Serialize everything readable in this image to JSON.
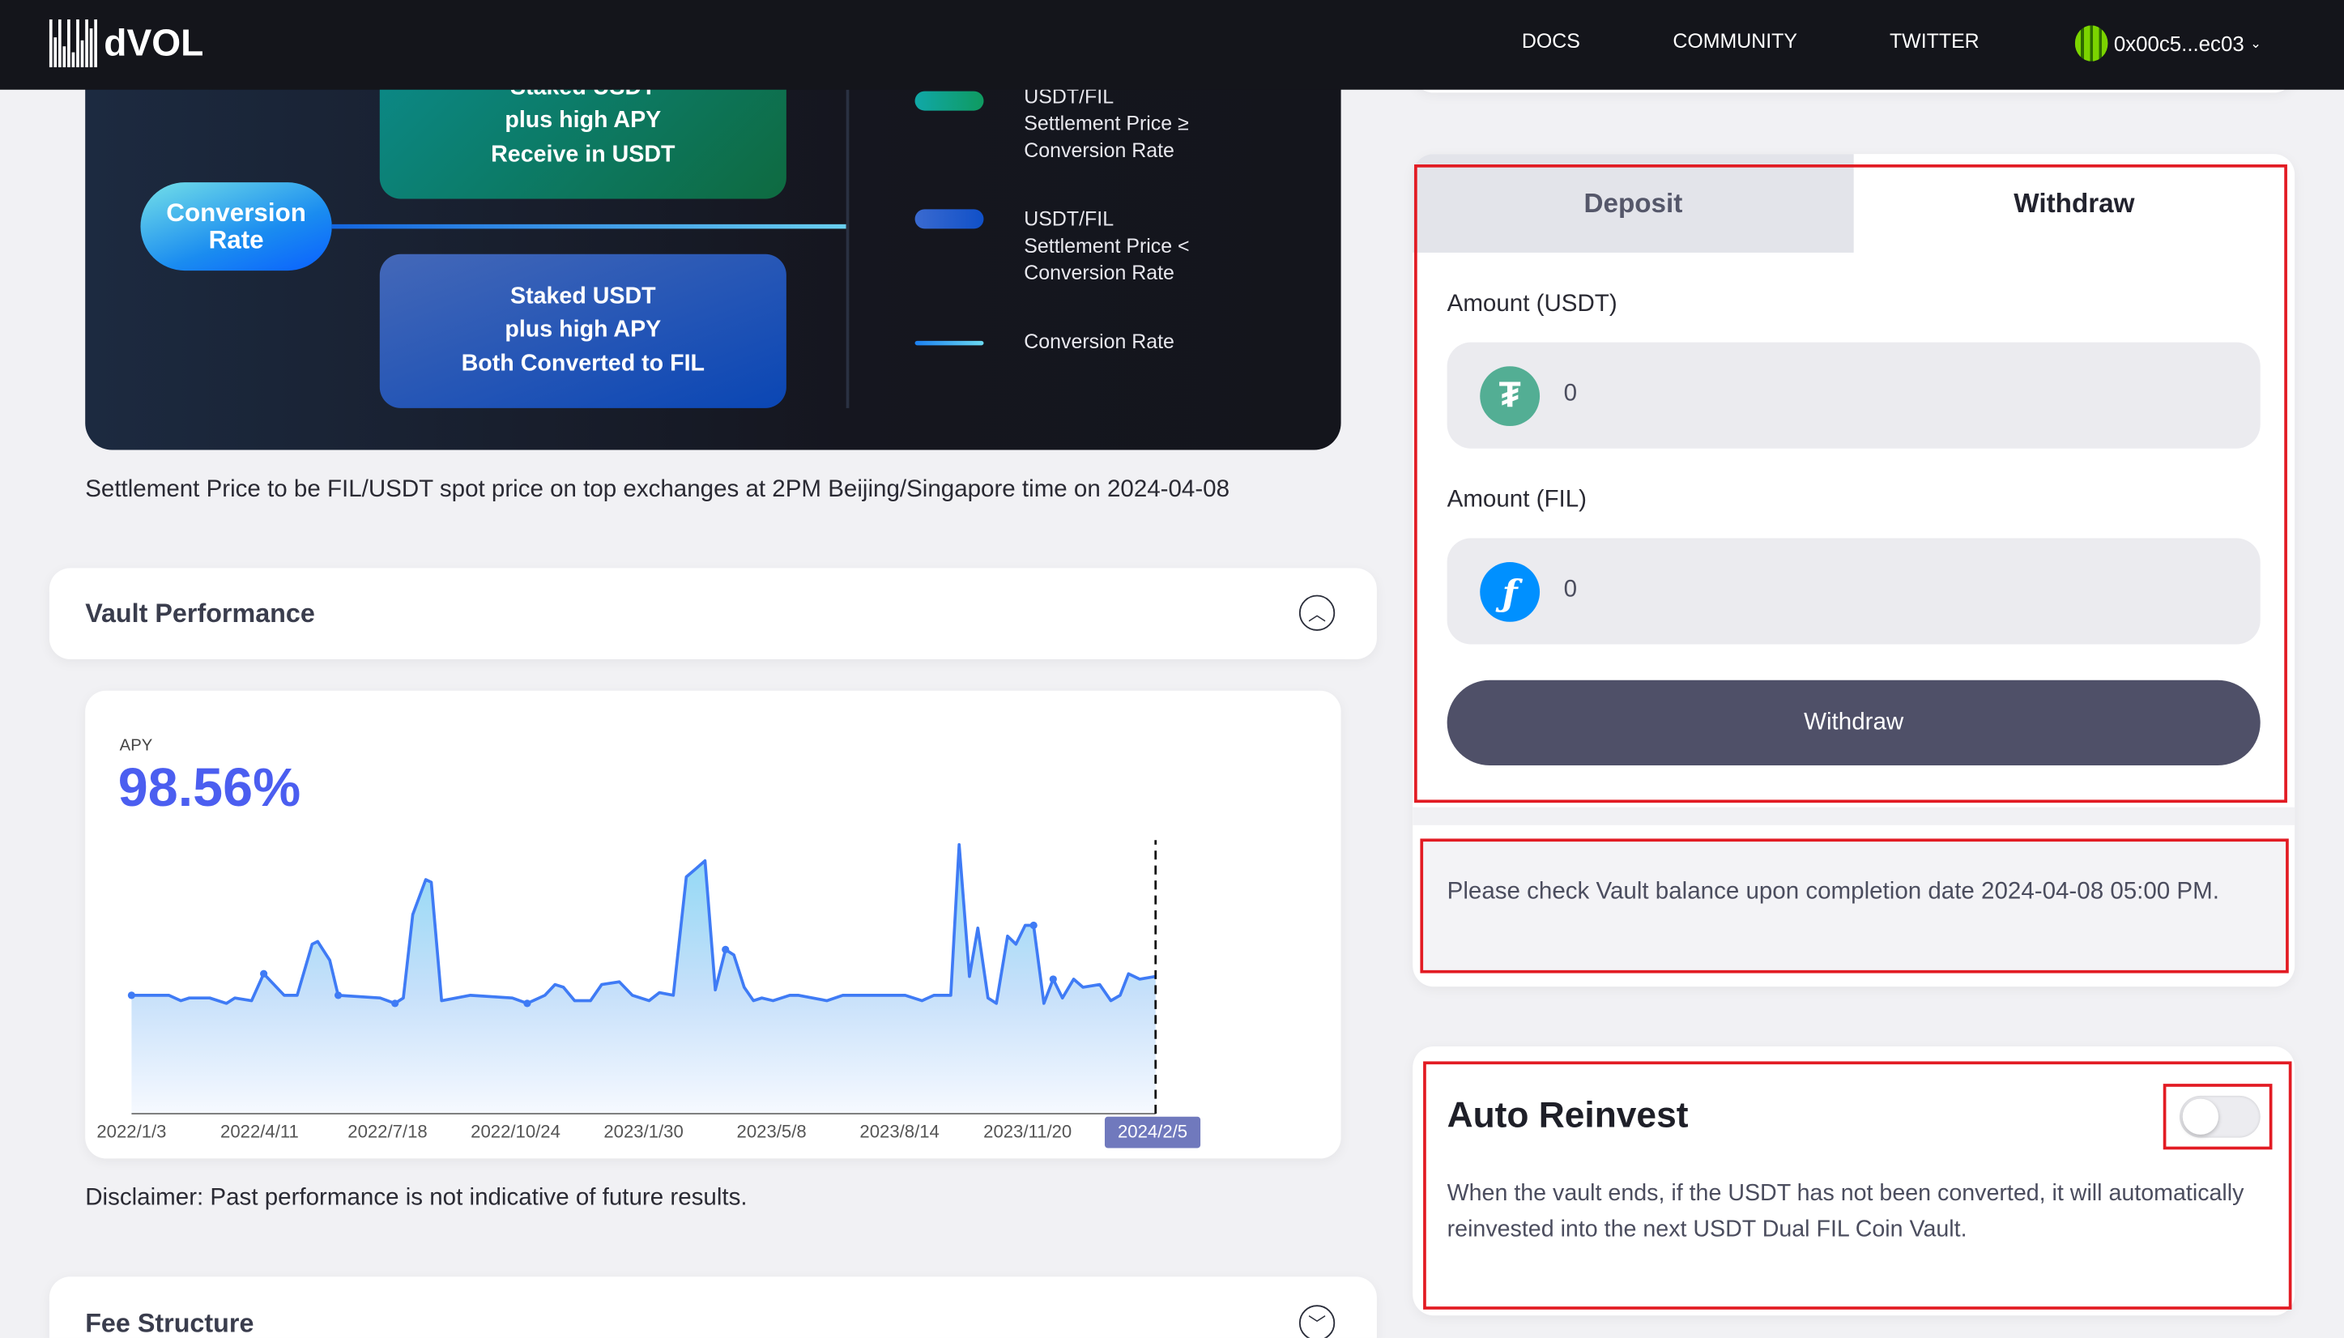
{
  "header": {
    "logo": "dVOL",
    "nav": [
      "DOCS",
      "COMMUNITY",
      "TWITTER"
    ],
    "wallet": "0x00c5...ec03"
  },
  "diagram": {
    "top_box": [
      "Staked USDT",
      "plus high APY",
      "Receive in USDT"
    ],
    "bottom_box": [
      "Staked USDT",
      "plus high APY",
      "Both Converted to FIL"
    ],
    "pill": [
      "Conversion",
      "Rate"
    ],
    "legend": [
      {
        "lines": [
          "USDT/FIL",
          "Settlement Price ≥",
          "Conversion Rate"
        ],
        "color": "#10a08a"
      },
      {
        "lines": [
          "USDT/FIL",
          "Settlement Price <",
          "Conversion Rate"
        ],
        "color": "#2a62d0"
      },
      {
        "lines": [
          "Conversion Rate"
        ],
        "color": "#3ab0f0"
      }
    ]
  },
  "settlement_note": "Settlement Price to be FIL/USDT spot price on top exchanges at 2PM Beijing/Singapore time on 2024-04-08",
  "vault_performance": {
    "title": "Vault Performance"
  },
  "apy": {
    "label": "APY",
    "value": "98.56%"
  },
  "chart_data": {
    "type": "area",
    "title": "APY",
    "xlabel": "",
    "ylabel": "",
    "x_unit": "weeks since 2022/1/3",
    "ylim": [
      0,
      100
    ],
    "tick_labels": [
      "2022/1/3",
      "2022/4/11",
      "2022/7/18",
      "2022/10/24",
      "2023/1/30",
      "2023/5/8",
      "2023/8/14",
      "2023/11/20",
      "2024/2/5"
    ],
    "highlighted_tick": "2024/2/5",
    "x": [
      0,
      4,
      5.3,
      6.2,
      8.4,
      10.2,
      11.1,
      12.9,
      14.2,
      16.4,
      17.8,
      19.4,
      20,
      21.3,
      22.2,
      26.7,
      28.3,
      29.2,
      30.2,
      31.6,
      32.2,
      33.3,
      36.4,
      40.9,
      42.5,
      44.4,
      45.5,
      46.4,
      47.6,
      49.3,
      50.5,
      52.4,
      53.8,
      55.6,
      56.7,
      58.2,
      59.6,
      60.6,
      61.6,
      62.7,
      63.8,
      64.7,
      65.8,
      66.8,
      67.7,
      68.9,
      70.7,
      71.6,
      74.7,
      76.4,
      80,
      83.1,
      84.9,
      86.2,
      88,
      88.9,
      90,
      90.9,
      92,
      92.9,
      94.1,
      95,
      96,
      96.9,
      98,
      99,
      100,
      101.2,
      102.2,
      104,
      105.2,
      106.2,
      107.1,
      108.3,
      110
    ],
    "values": [
      44,
      44,
      42,
      43,
      43,
      41,
      43,
      42,
      52,
      44,
      44,
      63,
      64,
      57,
      44,
      43,
      41,
      43,
      74,
      87,
      86,
      42,
      44,
      43,
      41,
      44,
      48,
      47,
      42,
      42,
      48,
      49,
      44,
      42,
      45,
      44,
      88,
      91,
      94,
      46,
      61,
      59,
      47,
      42,
      43,
      42,
      44,
      44,
      42,
      44,
      44,
      44,
      42,
      44,
      44,
      100,
      51,
      69,
      43,
      41,
      66,
      63,
      70,
      70,
      41,
      50,
      43,
      50,
      47,
      48,
      42,
      44,
      52,
      50,
      51
    ],
    "marker_x": [
      0,
      14.2,
      22.2,
      28.3,
      42.5,
      63.8,
      96.9,
      99
    ],
    "current_x": 110
  },
  "disclaimer": "Disclaimer: Past performance is not indicative of future results.",
  "fee_structure": {
    "title": "Fee Structure"
  },
  "form": {
    "tabs": [
      "Deposit",
      "Withdraw"
    ],
    "active_tab": "Withdraw",
    "usdt_label": "Amount (USDT)",
    "usdt_value": "0",
    "fil_label": "Amount (FIL)",
    "fil_value": "0",
    "submit": "Withdraw"
  },
  "notice": "Please check Vault balance upon completion date 2024-04-08 05:00 PM.",
  "auto_reinvest": {
    "title": "Auto Reinvest",
    "enabled": false,
    "description": "When the vault ends, if the USDT has not been converted, it will automatically reinvested into the next USDT Dual FIL Coin Vault."
  }
}
